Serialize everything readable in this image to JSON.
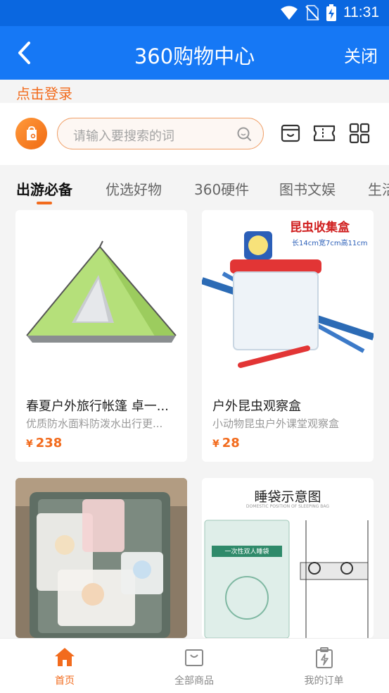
{
  "status_bar": {
    "time": "11:31"
  },
  "header": {
    "title": "360购物中心",
    "close_label": "关闭"
  },
  "login": {
    "label": "点击登录"
  },
  "search": {
    "placeholder": "请输入要搜索的词"
  },
  "tabs": [
    {
      "label": "出游必备",
      "active": true
    },
    {
      "label": "优选好物"
    },
    {
      "label": "360硬件"
    },
    {
      "label": "图书文娱"
    },
    {
      "label": "生活"
    }
  ],
  "products": [
    {
      "title": "春夏户外旅行帐篷 卓一...",
      "subtitle": "优质防水面料防泼水出行更...",
      "currency": "¥",
      "price": "238"
    },
    {
      "title": "户外昆虫观察盒",
      "subtitle": "小动物昆虫户外课堂观察盒",
      "currency": "¥",
      "price": "28",
      "image_text": {
        "heading": "昆虫收集盒",
        "dims": "长14cm宽7cm高11cm"
      }
    },
    {
      "image_text": {}
    },
    {
      "image_text": {
        "heading": "睡袋示意图",
        "caption": "DOMESTIC POSITION OF SLEEPING BAG",
        "package_label": "一次性双人睡袋"
      }
    }
  ],
  "bottom_nav": [
    {
      "label": "首页",
      "active": true,
      "icon": "home-icon"
    },
    {
      "label": "全部商品",
      "icon": "shopping-bag-icon"
    },
    {
      "label": "我的订单",
      "icon": "order-clipboard-icon"
    }
  ],
  "colors": {
    "status_bar": "#0a67e0",
    "app_bar": "#1678f5",
    "accent": "#f26b1d"
  }
}
